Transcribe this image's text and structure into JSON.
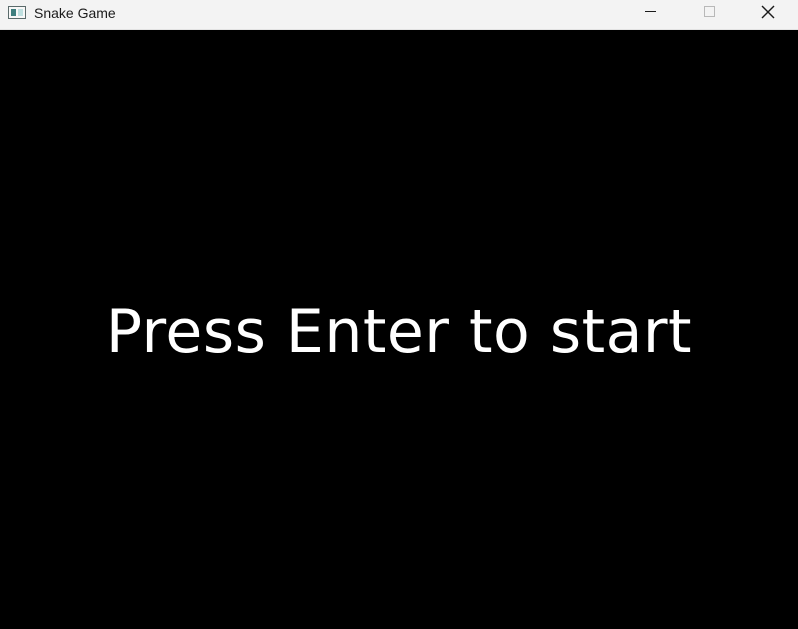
{
  "window": {
    "title": "Snake Game",
    "icon": "app-window-icon",
    "controls": {
      "minimize": "minimize-icon",
      "maximize": "maximize-icon",
      "close": "close-icon"
    }
  },
  "game": {
    "background_color": "#000000",
    "text_color": "#ffffff",
    "prompt": "Press Enter to start"
  }
}
